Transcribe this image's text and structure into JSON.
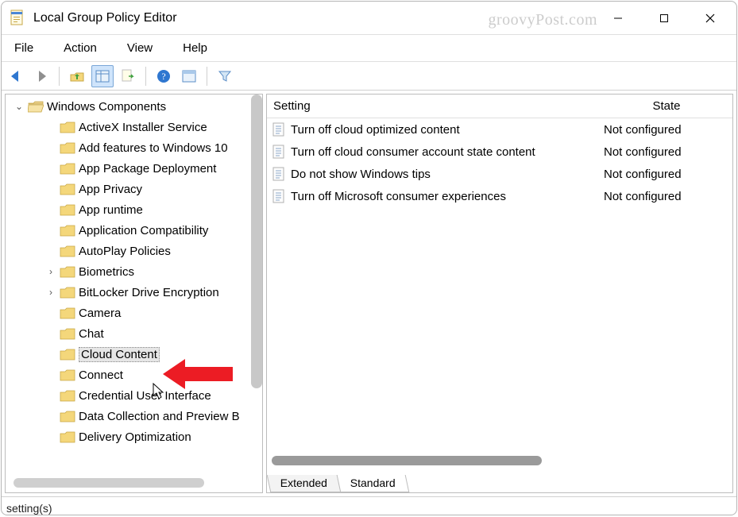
{
  "window": {
    "title": "Local Group Policy Editor",
    "watermark": "groovyPost.com"
  },
  "menu": {
    "file": "File",
    "action": "Action",
    "view": "View",
    "help": "Help"
  },
  "toolbar_icons": {
    "back": "back-icon",
    "forward": "forward-icon",
    "up": "up-icon",
    "details": "details-icon",
    "export": "export-icon",
    "help": "help-icon",
    "properties": "properties-icon",
    "filter": "filter-icon"
  },
  "tree": {
    "root": {
      "label": "Windows Components",
      "expanded": true
    },
    "items": [
      {
        "label": "ActiveX Installer Service",
        "expandable": false
      },
      {
        "label": "Add features to Windows 10",
        "expandable": false
      },
      {
        "label": "App Package Deployment",
        "expandable": false
      },
      {
        "label": "App Privacy",
        "expandable": false
      },
      {
        "label": "App runtime",
        "expandable": false
      },
      {
        "label": "Application Compatibility",
        "expandable": false
      },
      {
        "label": "AutoPlay Policies",
        "expandable": false
      },
      {
        "label": "Biometrics",
        "expandable": true
      },
      {
        "label": "BitLocker Drive Encryption",
        "expandable": true
      },
      {
        "label": "Camera",
        "expandable": false
      },
      {
        "label": "Chat",
        "expandable": false
      },
      {
        "label": "Cloud Content",
        "expandable": false,
        "selected": true
      },
      {
        "label": "Connect",
        "expandable": false
      },
      {
        "label": "Credential User Interface",
        "expandable": false
      },
      {
        "label": "Data Collection and Preview B",
        "expandable": false
      },
      {
        "label": "Delivery Optimization",
        "expandable": false
      }
    ]
  },
  "grid": {
    "headers": {
      "setting": "Setting",
      "state": "State"
    },
    "rows": [
      {
        "setting": "Turn off cloud optimized content",
        "state": "Not configured"
      },
      {
        "setting": "Turn off cloud consumer account state content",
        "state": "Not configured"
      },
      {
        "setting": "Do not show Windows tips",
        "state": "Not configured"
      },
      {
        "setting": "Turn off Microsoft consumer experiences",
        "state": "Not configured"
      }
    ]
  },
  "tabs": {
    "extended": "Extended",
    "standard": "Standard"
  },
  "status": {
    "text": "setting(s)"
  }
}
